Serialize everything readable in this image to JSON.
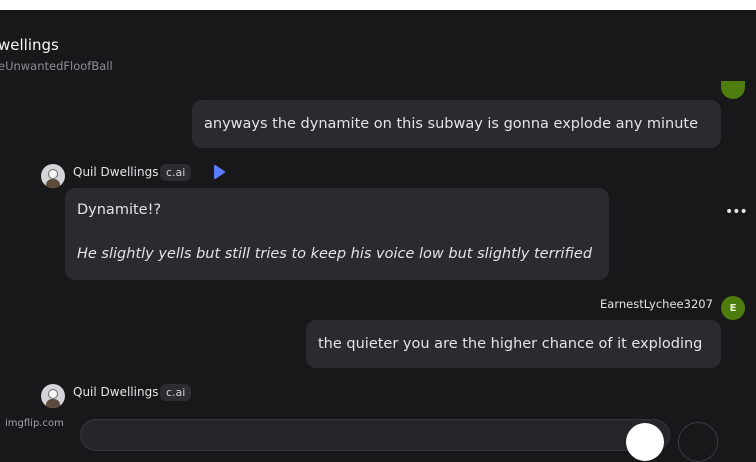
{
  "header": {
    "title": "wellings",
    "subtitle": "eUnwantedFloofBall"
  },
  "messages": [
    {
      "role": "user",
      "text": "anyways the dynamite on this subway is gonna explode any minute"
    },
    {
      "role": "character",
      "author": "Quil Dwellings",
      "badge": "c.ai",
      "line1": "Dynamite!?",
      "line2": "He slightly yells but still tries to keep his voice low but slightly terrified"
    },
    {
      "role": "user",
      "author": "EarnestLychee3207",
      "avatar_letter": "E",
      "text": "the quieter you are the higher chance of it exploding"
    },
    {
      "role": "character",
      "author": "Quil Dwellings",
      "badge": "c.ai"
    }
  ],
  "footer": {
    "watermark": "imgflip.com"
  },
  "colors": {
    "background": "#18181b",
    "bubble": "#2b2b2f",
    "user_avatar": "#4d7c0f",
    "play_accent": "#5b7cfa"
  },
  "icons": {
    "play": "play-icon",
    "more": "more-options-icon"
  }
}
